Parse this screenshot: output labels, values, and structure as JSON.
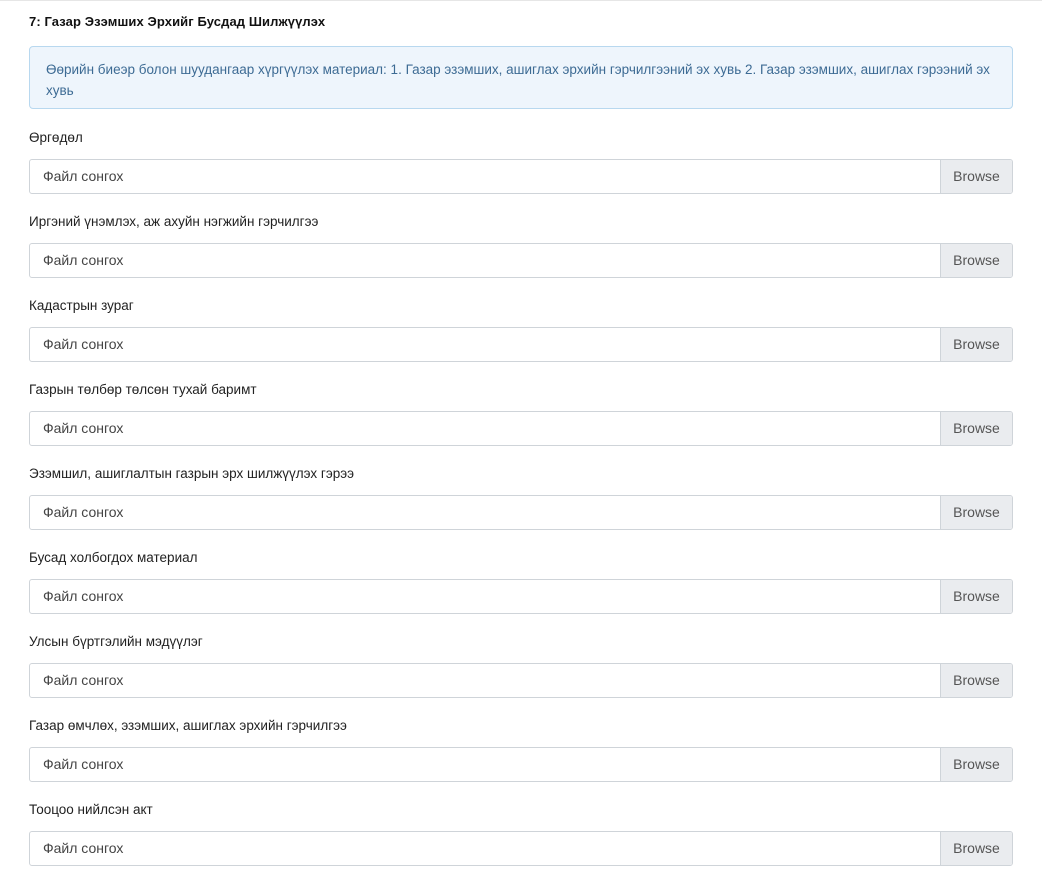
{
  "section": {
    "title": "7: Газар Эзэмших Эрхийг Бусдад Шилжүүлэх",
    "info": "Өөрийн биеэр болон шуудангаар хүргүүлэх материал: 1. Газар эзэмших, ашиглах эрхийн гэрчилгээний эх хувь 2. Газар эзэмших, ашиглах гэрээний эх хувь"
  },
  "fields": [
    {
      "label": "Өргөдөл",
      "placeholder": "Файл сонгох",
      "button": "Browse"
    },
    {
      "label": "Иргэний үнэмлэх, аж ахуйн нэгжийн гэрчилгээ",
      "placeholder": "Файл сонгох",
      "button": "Browse"
    },
    {
      "label": "Кадастрын зураг",
      "placeholder": "Файл сонгох",
      "button": "Browse"
    },
    {
      "label": "Газрын төлбөр төлсөн тухай баримт",
      "placeholder": "Файл сонгох",
      "button": "Browse"
    },
    {
      "label": "Эзэмшил, ашиглалтын газрын эрх шилжүүлэх гэрээ",
      "placeholder": "Файл сонгох",
      "button": "Browse"
    },
    {
      "label": "Бусад холбогдох материал",
      "placeholder": "Файл сонгох",
      "button": "Browse"
    },
    {
      "label": "Улсын бүртгэлийн мэдүүлэг",
      "placeholder": "Файл сонгох",
      "button": "Browse"
    },
    {
      "label": "Газар өмчлөх, эзэмших, ашиглах эрхийн гэрчилгээ",
      "placeholder": "Файл сонгох",
      "button": "Browse"
    },
    {
      "label": "Тооцоо нийлсэн акт",
      "placeholder": "Файл сонгох",
      "button": "Browse"
    }
  ]
}
